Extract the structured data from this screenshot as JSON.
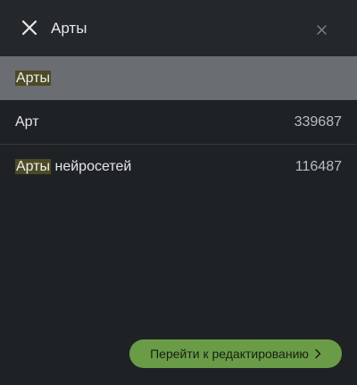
{
  "search": {
    "query": "Арты"
  },
  "results": [
    {
      "highlight": "Арты",
      "rest": "",
      "count": ""
    },
    {
      "highlight": "",
      "rest": "Арт",
      "count": "339687"
    },
    {
      "highlight": "Арты",
      "rest": " нейросетей",
      "count": "116487"
    }
  ],
  "footer": {
    "edit_label": "Перейти к редактированию"
  },
  "colors": {
    "background": "#1f2225",
    "selected_row": "#6a6e72",
    "highlight": "#4d4a24",
    "accent_button": "#6a9c48"
  },
  "icons": {
    "close": "close-icon",
    "clear": "clear-icon",
    "chevron": "chevron-right-icon"
  }
}
